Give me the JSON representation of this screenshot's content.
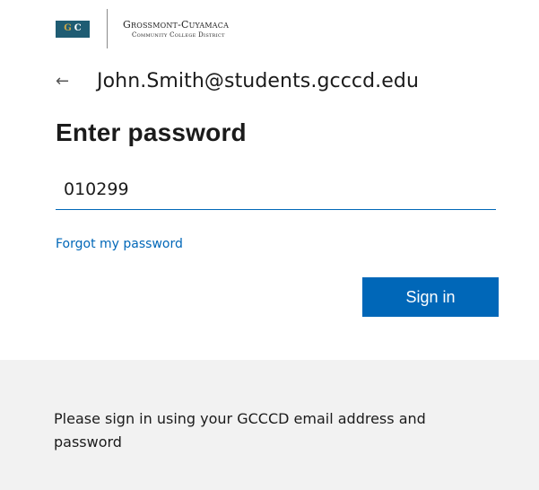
{
  "branding": {
    "logo_mark_letters": [
      "G",
      "C"
    ],
    "org_name": "Grossmont-Cuyamaca",
    "org_subtitle": "Community College District",
    "logo_colors": {
      "mark_background": "#1f5c73",
      "g_color": "#c9a64a",
      "c_color": "#ffffff"
    }
  },
  "identity": {
    "back_icon": "arrow-left-icon",
    "email": "John.Smith@students.gcccd.edu"
  },
  "title": "Enter password",
  "password": {
    "value": "010299"
  },
  "forgot_link": "Forgot my password",
  "sign_in_button": "Sign in",
  "info_panel_text": "Please sign in using your GCCCD email address and password",
  "colors": {
    "accent": "#0067b8",
    "panel_background": "#f2f2f2",
    "text": "#1b1b1b"
  }
}
